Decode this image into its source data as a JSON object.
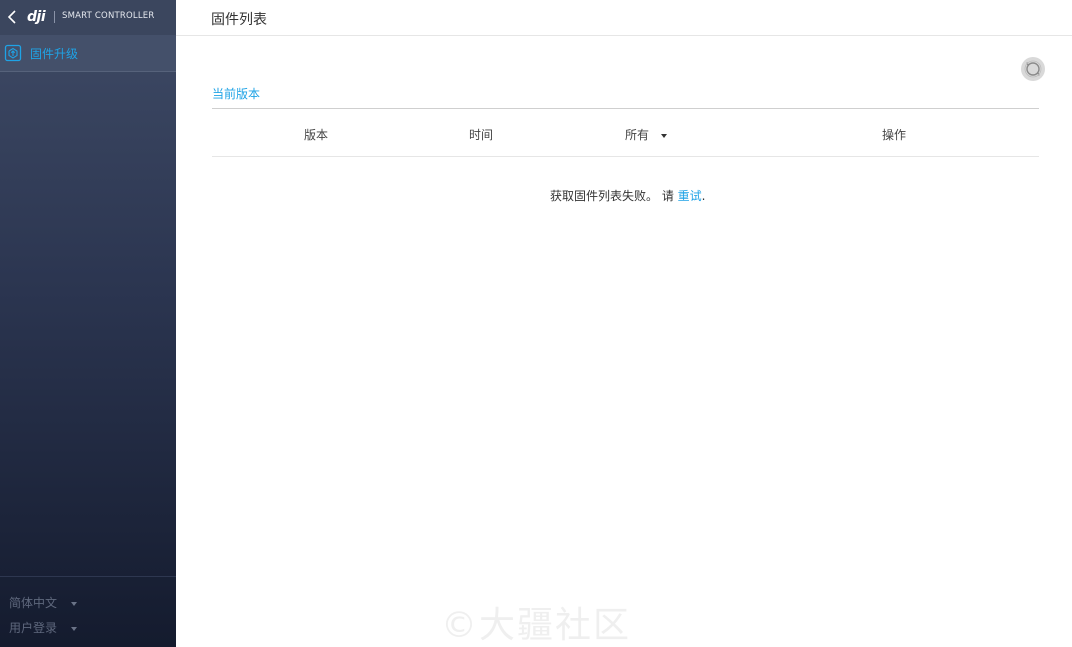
{
  "sidebar": {
    "brand_logo": "dji",
    "product_name": "SMART CONTROLLER",
    "items": [
      {
        "label": "固件升级",
        "icon": "firmware-box-icon"
      }
    ],
    "language_select": "简体中文",
    "login_select": "用户登录"
  },
  "header": {
    "title": "固件列表"
  },
  "main": {
    "section_title": "当前版本",
    "table": {
      "columns": [
        "版本",
        "时间",
        "所有",
        "操作"
      ]
    },
    "empty_message": "获取固件列表失败。 请 ",
    "retry_label": "重试",
    "retry_suffix": ".",
    "watermark": "©大疆社区"
  },
  "colors": {
    "accent": "#1fa3e6",
    "sidebar_top": "#3f4b66",
    "sidebar_bottom": "#141b2e"
  }
}
